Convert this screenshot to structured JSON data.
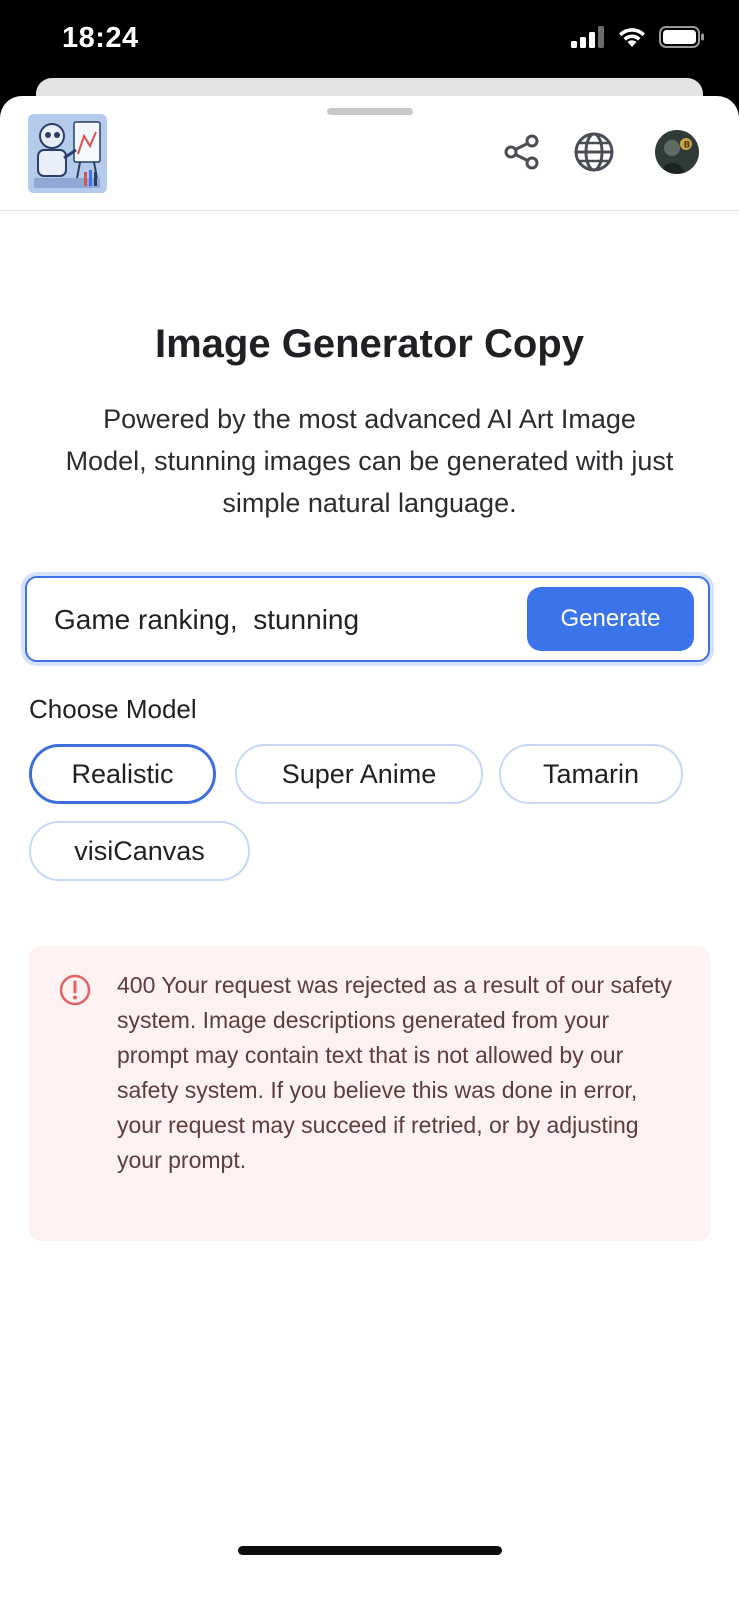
{
  "status_bar": {
    "time": "18:24",
    "icons": [
      "signal-icon",
      "wifi-icon",
      "battery-icon"
    ]
  },
  "header": {
    "logo": "robot-painter-logo",
    "icons": [
      "share-icon",
      "globe-icon",
      "user-avatar"
    ]
  },
  "main": {
    "title": "Image Generator Copy",
    "subtitle": "Powered by the most advanced AI Art Image Model, stunning images can be generated with just simple natural language.",
    "prompt": {
      "value": "Game ranking,  stunning",
      "placeholder": ""
    },
    "generate_label": "Generate",
    "choose_model_label": "Choose Model",
    "models": [
      {
        "label": "Realistic",
        "selected": true
      },
      {
        "label": "Super Anime",
        "selected": false
      },
      {
        "label": "Tamarin",
        "selected": false
      },
      {
        "label": "visiCanvas",
        "selected": false
      }
    ],
    "error": {
      "icon": "alert-circle-icon",
      "message": "400 Your request was rejected as a result of our safety system. Image descriptions generated from your prompt may contain text that is not allowed by our safety system. If you believe this was done in error, your request may succeed if retried, or by adjusting your prompt."
    }
  },
  "colors": {
    "accent": "#3b74ea",
    "chip_border": "#c8d8f6",
    "error_bg": "#fdf1f1",
    "error_icon": "#e06464"
  }
}
